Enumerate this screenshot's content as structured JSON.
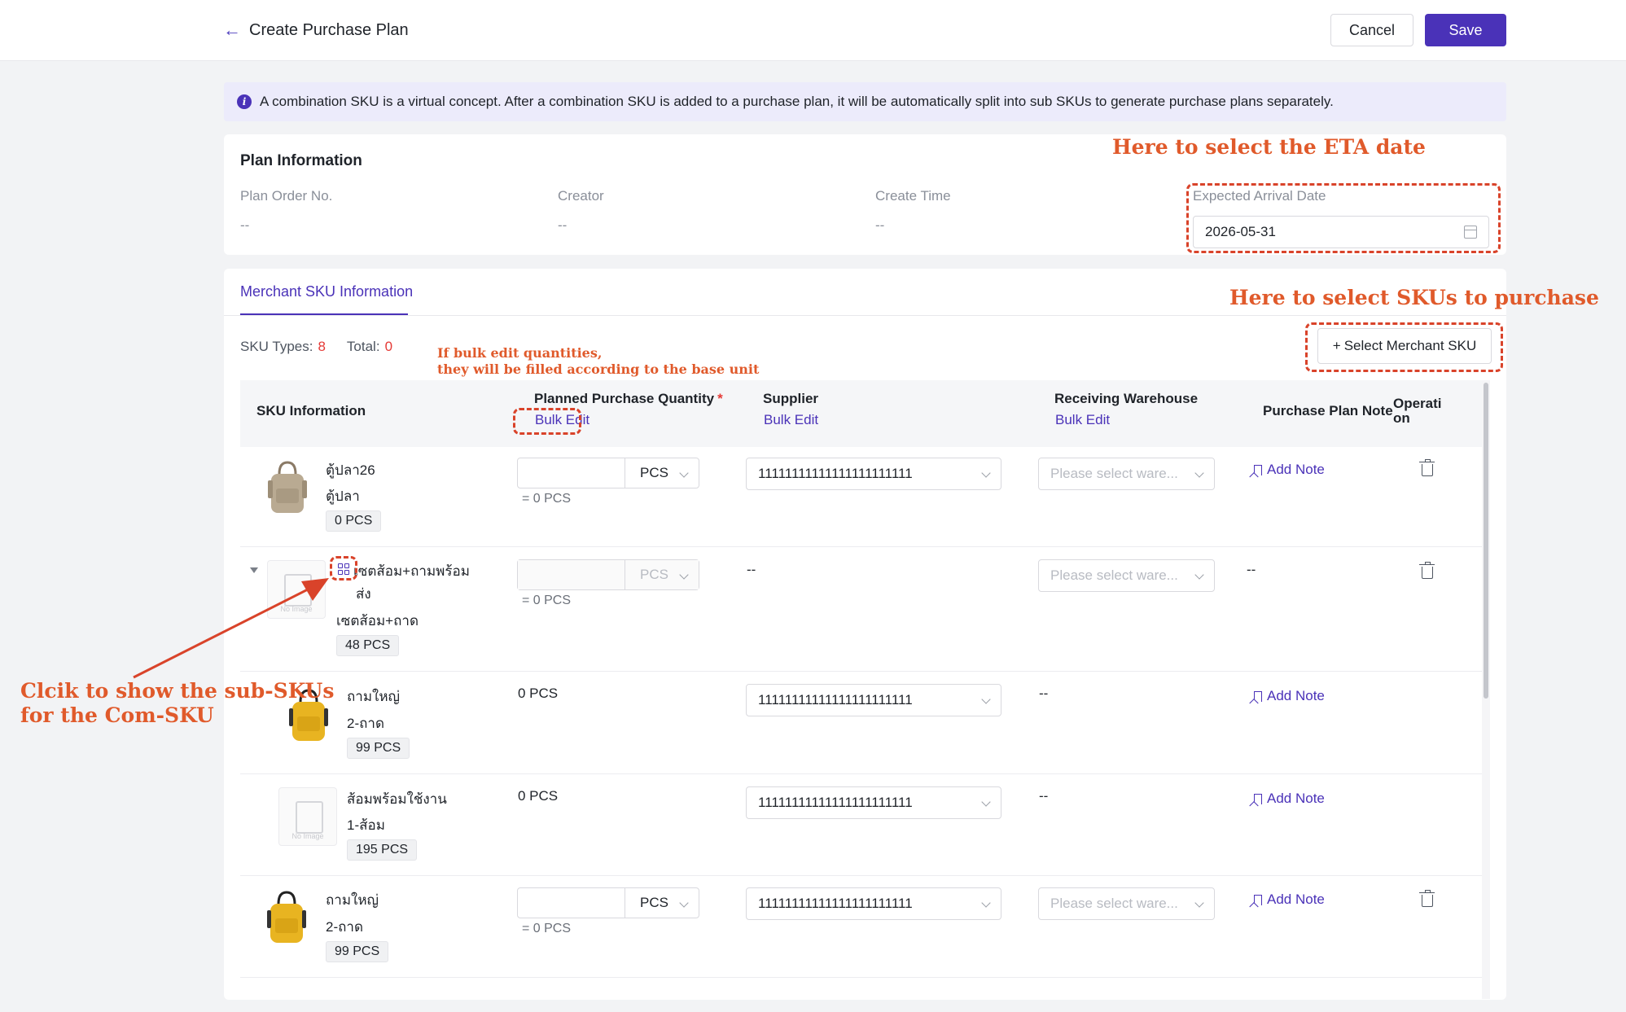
{
  "header": {
    "back_label": "Create Purchase Plan",
    "cancel_label": "Cancel",
    "save_label": "Save"
  },
  "notice": {
    "text": "A combination SKU is a virtual concept. After a combination SKU is added to a purchase plan, it will be automatically split into sub SKUs to generate purchase plans separately."
  },
  "plan": {
    "title": "Plan Information",
    "fields": [
      {
        "label": "Plan Order No.",
        "value": "--"
      },
      {
        "label": "Creator",
        "value": "--"
      },
      {
        "label": "Create Time",
        "value": "--"
      }
    ],
    "eta_label": "Expected Arrival Date",
    "eta_value": "2026-05-31"
  },
  "sku": {
    "tab": "Merchant SKU Information",
    "types_label": "SKU Types:",
    "types_value": "8",
    "total_label": "Total:",
    "total_value": "0",
    "select_button": "Select Merchant SKU",
    "columns": {
      "info": "SKU Information",
      "qty": "Planned Purchase Quantity",
      "qty_required": "*",
      "supplier": "Supplier",
      "warehouse": "Receiving Warehouse",
      "note": "Purchase Plan Note",
      "operation_1": "Operati",
      "operation_2": "on",
      "bulk_edit": "Bulk Edit"
    },
    "rows": [
      {
        "name": "ตู้ปลา26",
        "sub": "ตู้ปลา",
        "badge": "0 PCS",
        "unit": "PCS",
        "eq": "= 0 PCS",
        "supplier": "11111111111111111111111",
        "warehouse_placeholder": "Please select ware...",
        "note": "Add Note"
      },
      {
        "name_1": "เซตส้อม+ถามพร้อม",
        "name_2": "ส่ง",
        "sub": "เซตส้อม+ถาด",
        "badge": "48 PCS",
        "unit": "PCS",
        "eq": "= 0 PCS",
        "supplier": "--",
        "warehouse_placeholder": "Please select ware...",
        "note": "--"
      },
      {
        "name": "ถามใหญ่",
        "sub": "2-ถาด",
        "badge": "99 PCS",
        "qty": "0 PCS",
        "supplier": "11111111111111111111111",
        "warehouse": "--",
        "note": "Add Note"
      },
      {
        "name": "ส้อมพร้อมใช้งาน",
        "sub": "1-ส้อม",
        "badge": "195 PCS",
        "qty": "0 PCS",
        "supplier": "11111111111111111111111",
        "warehouse": "--",
        "note": "Add Note"
      },
      {
        "name": "ถามใหญ่",
        "sub": "2-ถาด",
        "badge": "99 PCS",
        "unit": "PCS",
        "eq": "= 0 PCS",
        "supplier": "11111111111111111111111",
        "warehouse_placeholder": "Please select ware...",
        "note": "Add Note"
      }
    ]
  },
  "annotations": {
    "eta": "Here to select the ETA date",
    "skus": "Here to select SKUs to purchase",
    "bulk_1": "If bulk edit quantities,",
    "bulk_2": "they will be filled according to the base unit",
    "combo_1": "Clcik to show the sub-SKUs",
    "combo_2": "for the Com-SKU",
    "color": "#d9432a"
  }
}
